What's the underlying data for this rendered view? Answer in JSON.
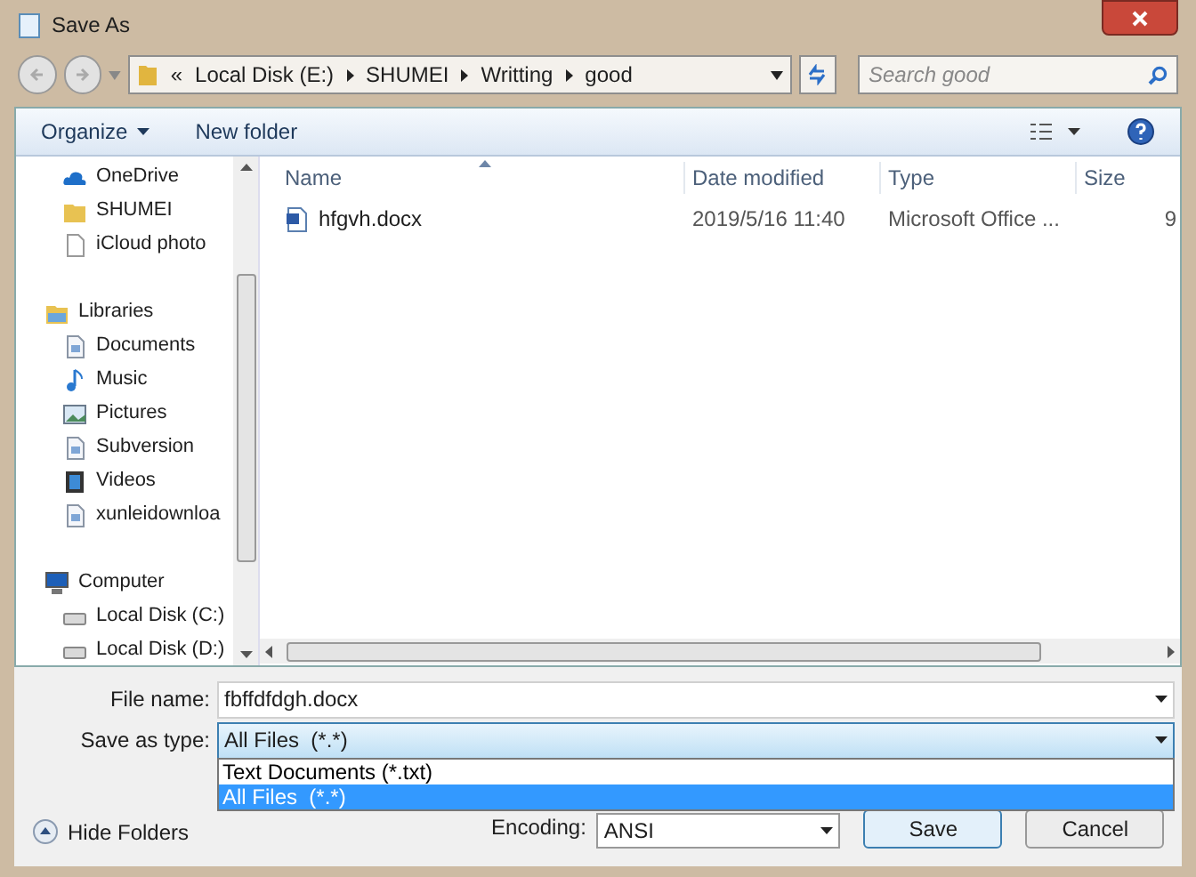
{
  "window": {
    "title": "Save As"
  },
  "address": {
    "crumbs": [
      "«",
      "Local Disk (E:)",
      "SHUMEI",
      "Writting",
      "good"
    ]
  },
  "search": {
    "placeholder": "Search good"
  },
  "toolbar": {
    "buttons": [
      "Organize",
      "New folder"
    ]
  },
  "sidebar": {
    "items": [
      {
        "label": "OneDrive",
        "kind": "cloud"
      },
      {
        "label": "SHUMEI",
        "kind": "folder"
      },
      {
        "label": "iCloud photo",
        "kind": "file"
      },
      {
        "label": "Libraries",
        "kind": "libraries",
        "children": [
          {
            "label": "Documents",
            "kind": "document"
          },
          {
            "label": "Music",
            "kind": "music"
          },
          {
            "label": "Pictures",
            "kind": "pictures"
          },
          {
            "label": "Subversion",
            "kind": "document"
          },
          {
            "label": "Videos",
            "kind": "videos"
          },
          {
            "label": "xunleidownloa",
            "kind": "document"
          }
        ]
      },
      {
        "label": "Computer",
        "kind": "computer",
        "children": [
          {
            "label": "Local Disk (C:)",
            "kind": "disk"
          },
          {
            "label": "Local Disk (D:)",
            "kind": "disk"
          }
        ]
      }
    ]
  },
  "table": {
    "columns": [
      "Name",
      "Date modified",
      "Type",
      "Size"
    ],
    "rows": [
      [
        "hfgvh.docx",
        "2019/5/16 11:40",
        "Microsoft Office ...",
        "9"
      ]
    ]
  },
  "form": {
    "file_name_label": "File name:",
    "file_name": "fbffdfdgh.docx",
    "type_label": "Save as type:",
    "type_value": "All Files  (*.*)",
    "type_options": [
      {
        "label": "Text Documents (*.txt)",
        "selected": false
      },
      {
        "label": "All Files  (*.*)",
        "selected": true
      }
    ],
    "encoding_label": "Encoding:",
    "encoding": "ANSI"
  },
  "hide_folders": "Hide Folders",
  "buttons": [
    "Save",
    "Cancel"
  ]
}
